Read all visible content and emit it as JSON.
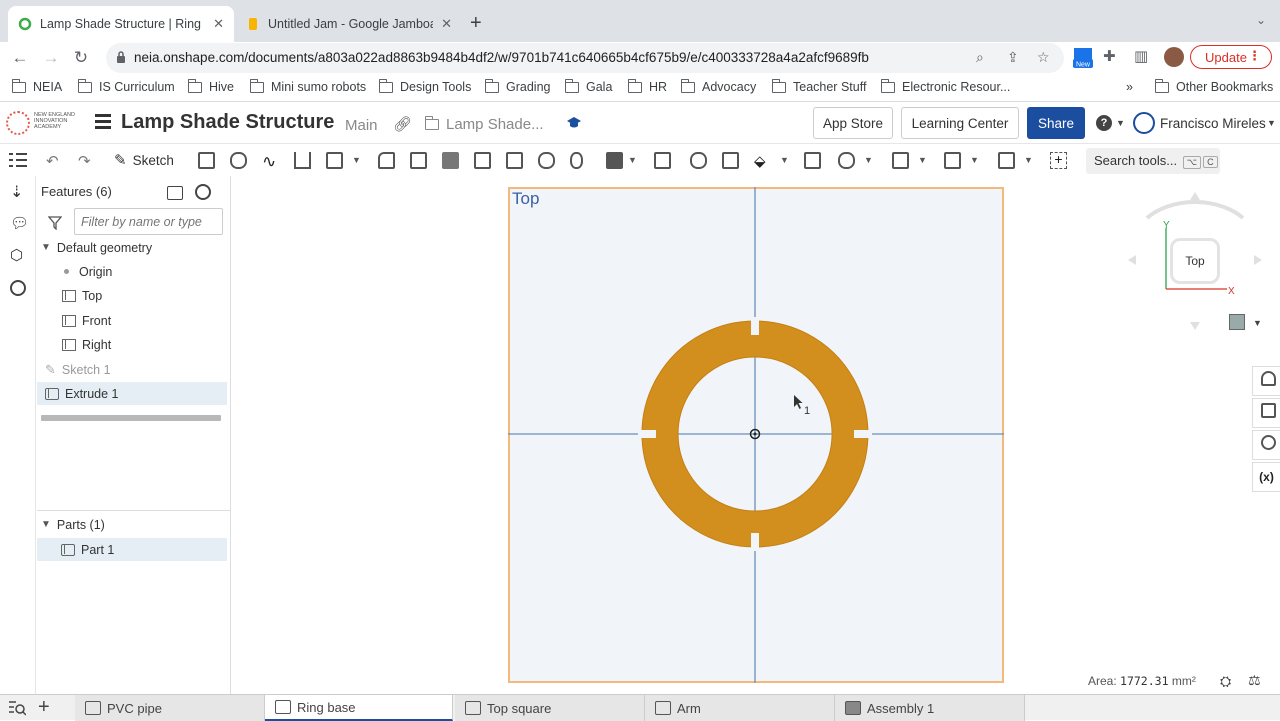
{
  "browser": {
    "tabs": [
      {
        "title": "Lamp Shade Structure | Ring b",
        "active": true
      },
      {
        "title": "Untitled Jam - Google Jamboar",
        "active": false
      }
    ],
    "url": "neia.onshape.com/documents/a803a022ad8863b9484b4df2/w/9701b741c640665b4cf675b9/e/c400333728a4a2afcf9689fb",
    "new_badge": "New",
    "update_label": "Update"
  },
  "bookmarks": [
    "NEIA",
    "IS Curriculum",
    "Hive",
    "Mini sumo robots",
    "Design Tools",
    "Grading",
    "Gala",
    "HR",
    "Advocacy",
    "Teacher Stuff",
    "Electronic Resour...",
    "Other Bookmarks"
  ],
  "header": {
    "logo_text": "NEW ENGLAND INNOVATION ACADEMY",
    "doc_title": "Lamp Shade Structure",
    "branch": "Main",
    "folder": "Lamp Shade...",
    "app_store": "App Store",
    "learning_center": "Learning Center",
    "share": "Share",
    "user": "Francisco Mireles"
  },
  "toolbar": {
    "sketch_label": "Sketch",
    "search_tools": "Search tools...",
    "search_key1": "⌥",
    "search_key2": "C"
  },
  "feature_panel": {
    "features_header": "Features (6)",
    "filter_placeholder": "Filter by name or type",
    "default_geometry": "Default geometry",
    "items": [
      "Origin",
      "Top",
      "Front",
      "Right",
      "Sketch 1",
      "Extrude 1"
    ],
    "parts_header": "Parts (1)",
    "parts": [
      "Part 1"
    ]
  },
  "viewport": {
    "plane_label": "Top",
    "viewcube_face": "Top",
    "axis_x": "X",
    "axis_y": "Y",
    "cursor_label": "1",
    "area_label": "Area:",
    "area_value": "1772.31",
    "area_unit": "mm²",
    "part_color": "#d28f1e",
    "plane_border_color": "#f3b97b"
  },
  "bottom_tabs": [
    {
      "label": "PVC pipe",
      "active": false
    },
    {
      "label": "Ring base",
      "active": true
    },
    {
      "label": "Top square",
      "active": false
    },
    {
      "label": "Arm",
      "active": false
    },
    {
      "label": "Assembly 1",
      "active": false
    }
  ]
}
